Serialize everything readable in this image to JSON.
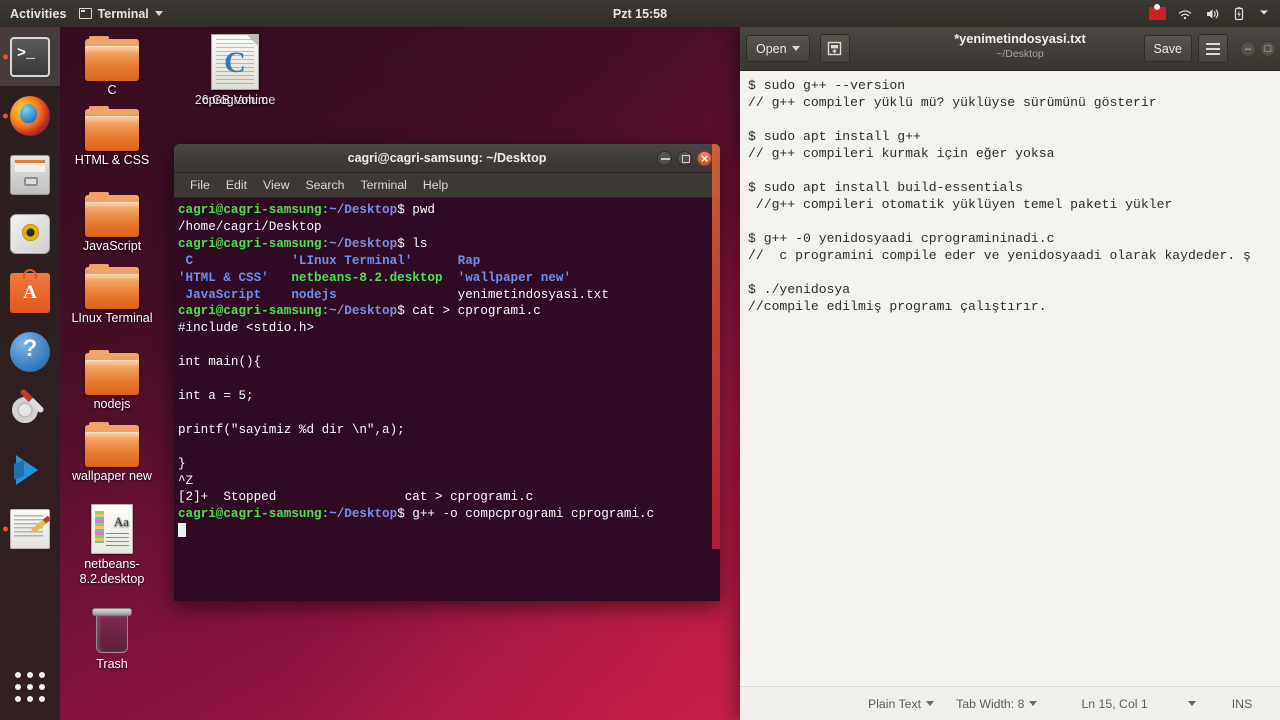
{
  "topbar": {
    "activities": "Activities",
    "app_menu": "Terminal",
    "app_menu_icon": "terminal-icon",
    "clock": "Pzt 15:58",
    "tray": [
      {
        "name": "screen-record-icon"
      },
      {
        "name": "wifi-icon"
      },
      {
        "name": "volume-icon"
      },
      {
        "name": "battery-icon"
      },
      {
        "name": "chevron-down-icon"
      }
    ]
  },
  "launcher": {
    "items": [
      {
        "name": "terminal",
        "icon": "terminal-icon",
        "running": true,
        "active": true
      },
      {
        "name": "firefox",
        "icon": "firefox-icon",
        "running": true,
        "active": false
      },
      {
        "name": "files",
        "icon": "files-icon",
        "running": false,
        "active": false
      },
      {
        "name": "rhythmbox",
        "icon": "rhythmbox-icon",
        "running": false,
        "active": false
      },
      {
        "name": "software",
        "icon": "ubuntu-software-icon",
        "running": false,
        "active": false
      },
      {
        "name": "help",
        "icon": "help-icon",
        "running": false,
        "active": false
      },
      {
        "name": "settings",
        "icon": "settings-icon",
        "running": false,
        "active": false
      },
      {
        "name": "vscode",
        "icon": "vscode-icon",
        "running": false,
        "active": false
      },
      {
        "name": "gedit",
        "icon": "gedit-icon",
        "running": true,
        "active": false
      }
    ],
    "show_apps": "show-applications-grid-icon"
  },
  "desktop_icons": [
    {
      "label": "C",
      "type": "folder"
    },
    {
      "label": "HTML & CSS",
      "type": "folder"
    },
    {
      "label": "JavaScript",
      "type": "folder"
    },
    {
      "label": "LInux Terminal",
      "type": "folder"
    },
    {
      "label": "nodejs",
      "type": "folder"
    },
    {
      "label": "wallpaper new",
      "type": "folder"
    },
    {
      "label": "netbeans-8.2.desktop",
      "type": "text-file"
    },
    {
      "label": "Trash",
      "type": "trash"
    }
  ],
  "desktop_overlap_icon": {
    "label_front": "cprogrami.c",
    "label_back": "26 GB Volume",
    "type": "c-source-file"
  },
  "terminal": {
    "title": "cagri@cagri-samsung: ~/Desktop",
    "menu": [
      "File",
      "Edit",
      "View",
      "Search",
      "Terminal",
      "Help"
    ],
    "window_buttons": [
      "minimize",
      "maximize",
      "close"
    ],
    "prompt": "cagri@cagri-samsung:",
    "prompt_path": "~/Desktop",
    "lines": [
      {
        "type": "prompt",
        "cmd": " pwd"
      },
      {
        "type": "plain",
        "text": "/home/cagri/Desktop"
      },
      {
        "type": "prompt",
        "cmd": " ls"
      },
      {
        "type": "ls1"
      },
      {
        "type": "ls2"
      },
      {
        "type": "ls3"
      },
      {
        "type": "prompt",
        "cmd": " cat > cprogrami.c"
      },
      {
        "type": "plain",
        "text": "#include <stdio.h>"
      },
      {
        "type": "plain",
        "text": ""
      },
      {
        "type": "plain",
        "text": "int main(){"
      },
      {
        "type": "plain",
        "text": ""
      },
      {
        "type": "plain",
        "text": "int a = 5;"
      },
      {
        "type": "plain",
        "text": ""
      },
      {
        "type": "plain",
        "text": "printf(\"sayimiz %d dir \\n\",a);"
      },
      {
        "type": "plain",
        "text": ""
      },
      {
        "type": "plain",
        "text": "}"
      },
      {
        "type": "plain",
        "text": "^Z"
      },
      {
        "type": "plain",
        "text": "[2]+  Stopped                 cat > cprogrami.c"
      },
      {
        "type": "prompt",
        "cmd": " g++ -o compcprogrami cprogrami.c"
      },
      {
        "type": "cursor"
      }
    ],
    "ls_row1": [
      " C",
      "'LInux Terminal'",
      "Rap"
    ],
    "ls_row2": [
      "'HTML & CSS'",
      "netbeans-8.2.desktop",
      "'wallpaper new'"
    ],
    "ls_row3": [
      " JavaScript",
      "nodejs",
      "yenimetindosyasi.txt"
    ]
  },
  "gedit": {
    "open_button": "Open",
    "save_button": "Save",
    "new_tab_icon": "new-document-icon",
    "menu_icon": "hamburger-menu-icon",
    "title": "*yenimetindosyasi.txt",
    "subtitle": "~/Desktop",
    "window_buttons": [
      "minimize",
      "maximize",
      "close"
    ],
    "content_lines": [
      "$ sudo g++ --version",
      "// g++ compiler yüklü mü? yüklüyse sürümünü gösterir",
      "",
      "$ sudo apt install g++",
      "// g++ compileri kurmak için eğer yoksa",
      "",
      "$ sudo apt install build-essentials",
      " //g++ compileri otomatik yüklüyen temel paketi yükler",
      "",
      "$ g++ -0 yenidosyaadi cprogramininadi.c",
      "//  c programini compile eder ve yenidosyaadi olarak kaydeder. ş",
      "",
      "$ ./yenidosya",
      "//compile edilmiş programı çalıştırır."
    ],
    "status": {
      "language": "Plain Text",
      "tab_width": "Tab Width: 8",
      "position": "Ln 15, Col 1",
      "insert_mode": "INS"
    }
  },
  "colors": {
    "ubuntu_orange": "#e95420",
    "terminal_bg": "#300a24",
    "prompt_green": "#4ee24e",
    "path_blue": "#7b8fe3",
    "gedit_bg": "#f3f2ee"
  }
}
